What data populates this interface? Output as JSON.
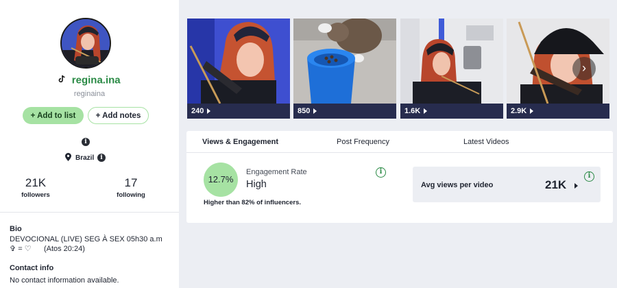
{
  "profile": {
    "handle": "regina.ina",
    "username": "reginaina",
    "add_to_list_label": "+ Add to list",
    "add_notes_label": "+ Add notes",
    "location": "Brazil",
    "followers_count": "21K",
    "followers_label": "followers",
    "following_count": "17",
    "following_label": "following",
    "bio_title": "Bio",
    "bio_line1": "DEVOCIONAL (LIVE) SEG À SEX 05h30 a.m",
    "bio_line2": "✞ = ♡      (Atos 20:24)",
    "contact_title": "Contact info",
    "contact_text": "No contact information available."
  },
  "videos": [
    {
      "views": "240",
      "icon": "play-icon"
    },
    {
      "views": "850",
      "icon": "play-icon"
    },
    {
      "views": "1.6K",
      "icon": "play-icon"
    },
    {
      "views": "2.9K",
      "icon": "play-icon"
    }
  ],
  "tabs": [
    {
      "label": "Views & Engagement",
      "active": true
    },
    {
      "label": "Post Frequency",
      "active": false
    },
    {
      "label": "Latest Videos",
      "active": false
    }
  ],
  "engagement": {
    "rate": "12.7%",
    "label": "Engagement Rate",
    "level": "High",
    "note": "Higher than 82% of influencers."
  },
  "avg_views": {
    "label": "Avg views per video",
    "value": "21K"
  },
  "colors": {
    "accent_green": "#2a8a45",
    "button_green": "#a6e2a3",
    "thumb_bar": "#272c4e"
  }
}
